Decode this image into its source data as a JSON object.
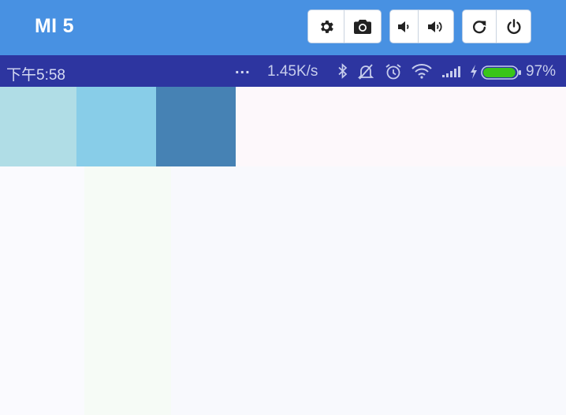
{
  "device_bar": {
    "device_name": "MI 5",
    "buttons": [
      {
        "icon": "gear-icon",
        "label": "settings"
      },
      {
        "icon": "camera-icon",
        "label": "screenshot"
      },
      {
        "icon": "volume-down-icon",
        "label": "volume down"
      },
      {
        "icon": "volume-up-icon",
        "label": "volume up"
      },
      {
        "icon": "rotate-icon",
        "label": "rotate"
      },
      {
        "icon": "power-icon",
        "label": "power"
      }
    ],
    "color": "#4891e2"
  },
  "status_bar": {
    "time": "下午5:58",
    "more": "...",
    "net_speed": "1.45K/s",
    "battery_percent": "97%",
    "battery_level": 0.97,
    "icons": [
      "bluetooth-icon",
      "mute-icon",
      "alarm-icon",
      "wifi-icon",
      "signal-icon",
      "charging-icon",
      "battery-icon"
    ],
    "color": "#2d35a0"
  },
  "swatches": [
    {
      "color": "#b0dde6"
    },
    {
      "color": "#88cde8"
    },
    {
      "color": "#4682b4"
    }
  ],
  "column_tints": [
    {
      "color": "#fafafe"
    },
    {
      "color": "#f6fbf6"
    },
    {
      "color": "#f8f9fd"
    }
  ]
}
